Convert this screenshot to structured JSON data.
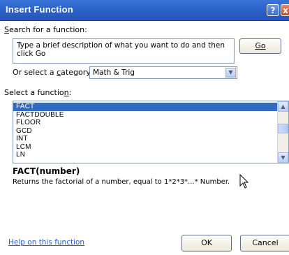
{
  "window": {
    "title": "Insert Function",
    "help_glyph": "?",
    "close_glyph": "x"
  },
  "search": {
    "label_prefix": "",
    "label_access_key": "S",
    "label_rest": "earch for a function:",
    "text": "Type a brief description of what you want to do and then click Go",
    "go_label": "Go"
  },
  "category": {
    "label_prefix": "Or select a ",
    "label_access_key": "c",
    "label_rest": "ategory:",
    "selected": "Math & Trig"
  },
  "function_list": {
    "label_prefix": "Select a functio",
    "label_access_key": "n",
    "label_rest": ":",
    "items": [
      "FACT",
      "FACTDOUBLE",
      "FLOOR",
      "GCD",
      "INT",
      "LCM",
      "LN"
    ],
    "selected_index": 0
  },
  "selected_function": {
    "signature": "FACT(number)",
    "description": "Returns the factorial of a number, equal to 1*2*3*...* Number."
  },
  "footer": {
    "help_link": "Help on this function",
    "ok_label": "OK",
    "cancel_label": "Cancel"
  },
  "colors": {
    "title_bar": "#2b5fc4",
    "selection": "#316ac5",
    "link": "#2c5bd0"
  }
}
